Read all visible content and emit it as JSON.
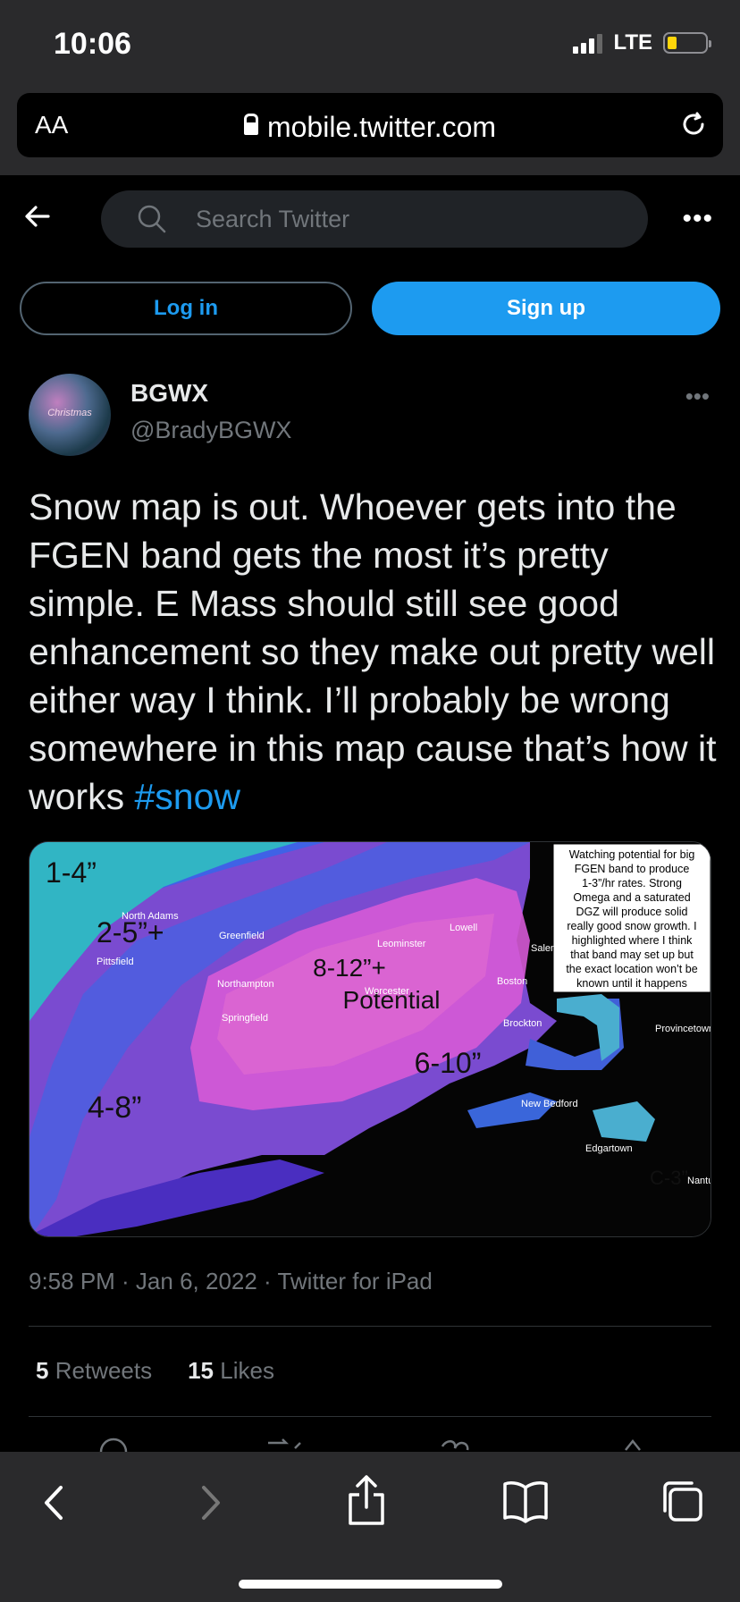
{
  "status": {
    "time": "10:06",
    "network": "LTE"
  },
  "browser": {
    "aa_label": "AA",
    "url": "mobile.twitter.com"
  },
  "header": {
    "search_placeholder": "Search Twitter",
    "more": "•••"
  },
  "auth": {
    "login_label": "Log in",
    "signup_label": "Sign up"
  },
  "tweet": {
    "author_name": "BGWX",
    "author_handle": "@BradyBGWX",
    "avatar_text": "Christmas",
    "more": "•••",
    "text": "Snow map is out. Whoever gets into the FGEN band gets the most it’s pretty simple. E Mass should still see good enhancement so they make out pretty well either way I think. I’ll probably be wrong somewhere in this map cause that’s how it works ",
    "hashtag": "#snow",
    "timestamp": "9:58 PM · Jan 6, 2022 · Twitter for iPad",
    "retweets_count": "5",
    "retweets_label": "Retweets",
    "likes_count": "15",
    "likes_label": "Likes"
  },
  "map": {
    "zones": [
      {
        "label": "1-4”"
      },
      {
        "label": "2-5”+"
      },
      {
        "label": "8-12”+"
      },
      {
        "label": "Potential"
      },
      {
        "label": "6-10”"
      },
      {
        "label": "4-8”"
      },
      {
        "label": "C-3”"
      }
    ],
    "towns": [
      "North Adams",
      "Pittsfield",
      "Greenfield",
      "Northampton",
      "Springfield",
      "Leominster",
      "Worcester",
      "Lowell",
      "Salem",
      "Boston",
      "Brockton",
      "New Bedford",
      "Edgartown",
      "Provincetown",
      "Nantucket"
    ],
    "note": [
      "Watching potential for big",
      "FGEN band to produce",
      "1-3”/hr rates. Strong",
      "Omega and a saturated",
      "DGZ will produce solid",
      "really good snow growth. I",
      "highlighted where I think",
      "that band may set up but",
      "the exact location won’t be",
      "known until it happens"
    ],
    "colors": {
      "cyan": "#35b8c7",
      "blue": "#4767e8",
      "purple": "#8456d6",
      "pink": "#d65ad6",
      "ocean": "#050505"
    }
  }
}
